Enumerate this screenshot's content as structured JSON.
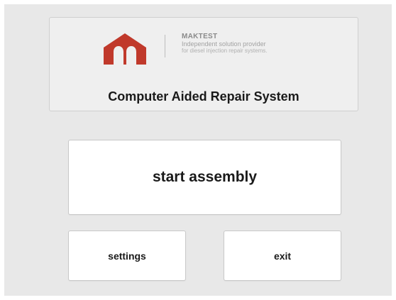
{
  "header": {
    "brand": {
      "name": "MAKTEST",
      "tagline_line1": "Independent solution provider",
      "tagline_line2": "for diesel injection repair systems.",
      "logo_color": "#c0392b"
    },
    "app_title": "Computer Aided Repair System"
  },
  "buttons": {
    "start_label": "start assembly",
    "settings_label": "settings",
    "exit_label": "exit"
  }
}
